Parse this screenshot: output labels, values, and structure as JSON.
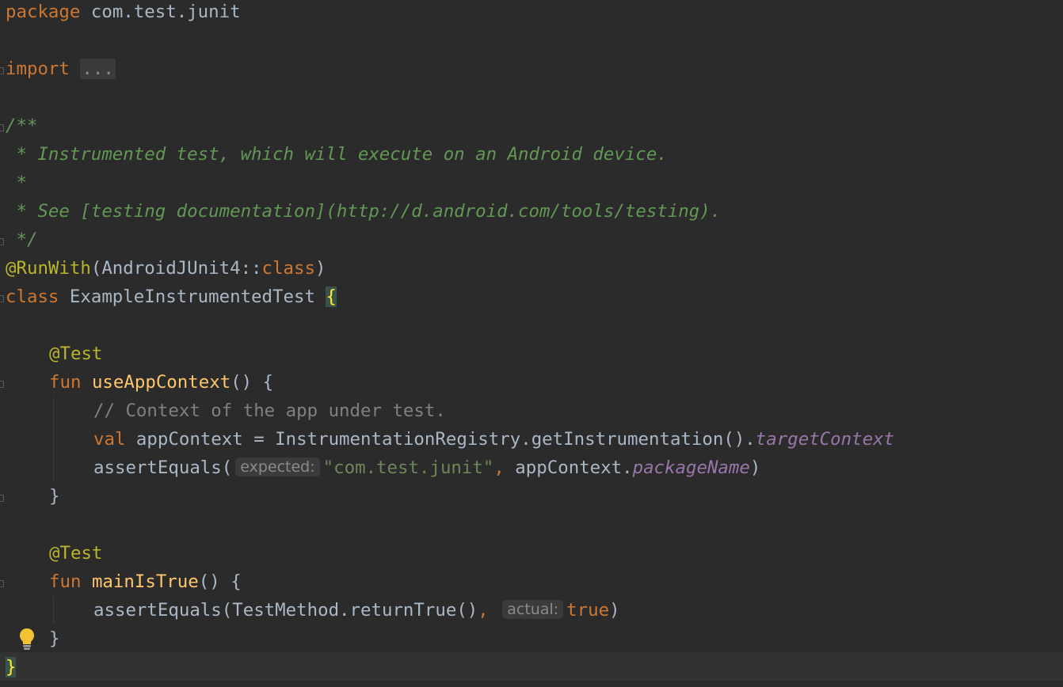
{
  "code": {
    "package_kw": "package",
    "package_name": " com.test.junit",
    "import_kw": "import",
    "import_folded": "...",
    "doc_open": "/**",
    "doc_line1": " * Instrumented test, which will execute on an Android device.",
    "doc_line2": " *",
    "doc_line3": " * See [testing documentation](http://d.android.com/tools/testing).",
    "doc_close": " */",
    "runwith_ann": "@RunWith",
    "runwith_open": "(AndroidJUnit4::",
    "runwith_class_kw": "class",
    "runwith_close": ")",
    "class_kw": "class",
    "class_name": " ExampleInstrumentedTest ",
    "class_open_brace": "{",
    "test_ann_1": "@Test",
    "fun_kw_1": "fun",
    "fun_name_1": "useAppContext",
    "fun_sig_1": "() {",
    "comment_1": "// Context of the app under test.",
    "val_kw": "val",
    "val_stmt": " appContext = InstrumentationRegistry.getInstrumentation().",
    "target_context": "targetContext",
    "assert_1_open": "assertEquals(",
    "hint_expected": "expected:",
    "assert_1_str": "\"com.test.junit\"",
    "assert_1_comma": ",",
    "assert_1_mid": " appContext.",
    "package_name_prop": "packageName",
    "assert_1_close": ")",
    "close_brace_1": "}",
    "test_ann_2": "@Test",
    "fun_kw_2": "fun",
    "fun_name_2": "mainIsTrue",
    "fun_sig_2": "() {",
    "assert_2_open": "assertEquals(TestMethod.returnTrue()",
    "assert_2_comma": ",",
    "hint_actual": "actual:",
    "assert_2_true": "true",
    "assert_2_close": ")",
    "close_brace_2": "}",
    "class_close_brace": "}"
  },
  "icons": {
    "gutter": "lightbulb-icon",
    "fold": "fold-marker-icon"
  },
  "colors": {
    "background": "#2b2b2b",
    "keyword": "#cc7832",
    "annotation": "#bbb529",
    "function": "#ffc66d",
    "doc_comment": "#629755",
    "comment": "#808080",
    "string": "#6a8759",
    "property": "#9876aa",
    "text": "#a9b7c6"
  }
}
